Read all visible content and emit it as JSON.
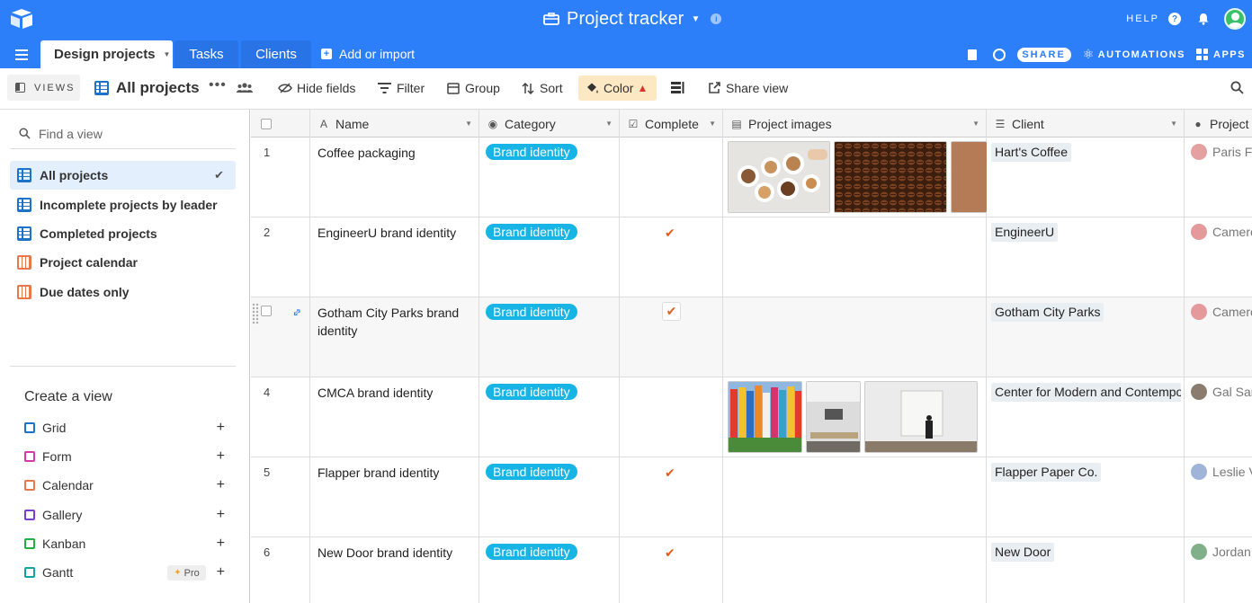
{
  "header": {
    "base_title": "Project tracker",
    "help": "HELP",
    "tabs": [
      {
        "label": "Design projects"
      },
      {
        "label": "Tasks"
      },
      {
        "label": "Clients"
      }
    ],
    "add_import": "Add or import",
    "share": "SHARE",
    "automations": "AUTOMATIONS",
    "apps": "APPS",
    "brand_color": "#2d7ff9"
  },
  "toolbar": {
    "views": "VIEWS",
    "current_view": "All projects",
    "hide_fields": "Hide fields",
    "filter": "Filter",
    "group": "Group",
    "sort": "Sort",
    "color": "Color",
    "share_view": "Share view"
  },
  "sidebar": {
    "find_placeholder": "Find a view",
    "views": [
      {
        "label": "All projects",
        "icon": "grid-icon",
        "selected": true
      },
      {
        "label": "Incomplete projects by leader",
        "icon": "grid-icon"
      },
      {
        "label": "Completed projects",
        "icon": "grid-icon"
      },
      {
        "label": "Project calendar",
        "icon": "calendar-icon"
      },
      {
        "label": "Due dates only",
        "icon": "calendar-icon"
      }
    ],
    "create_title": "Create a view",
    "create_items": [
      {
        "label": "Grid",
        "color": "#1d72c9"
      },
      {
        "label": "Form",
        "color": "#d63aa8"
      },
      {
        "label": "Calendar",
        "color": "#e8774a"
      },
      {
        "label": "Gallery",
        "color": "#7b3fd1"
      },
      {
        "label": "Kanban",
        "color": "#20b042"
      },
      {
        "label": "Gantt",
        "color": "#11a3a0"
      }
    ],
    "pro_label": "Pro"
  },
  "grid": {
    "columns": [
      "Name",
      "Category",
      "Complete",
      "Project images",
      "Client",
      "Project l"
    ],
    "rows": [
      {
        "num": "1",
        "name": "Coffee packaging",
        "category": "Brand identity",
        "complete": false,
        "client": "Hart's Coffee",
        "leader": "Paris Fo"
      },
      {
        "num": "2",
        "name": "EngineerU brand identity",
        "category": "Brand identity",
        "complete": true,
        "client": "EngineerU",
        "leader": "Camero"
      },
      {
        "num": "",
        "name": "Gotham City Parks brand identity",
        "category": "Brand identity",
        "complete": true,
        "client": "Gotham City Parks",
        "leader": "Camero"
      },
      {
        "num": "4",
        "name": "CMCA brand identity",
        "category": "Brand identity",
        "complete": false,
        "client": "Center for Modern and Contemporary Art",
        "leader": "Gal Sar"
      },
      {
        "num": "5",
        "name": "Flapper brand identity",
        "category": "Brand identity",
        "complete": true,
        "client": "Flapper Paper Co.",
        "leader": "Leslie V"
      },
      {
        "num": "6",
        "name": "New Door brand identity",
        "category": "Brand identity",
        "complete": true,
        "client": "New Door",
        "leader": "Jordan"
      }
    ],
    "category_color": "#19b4e6",
    "check_color": "#e25d1e"
  }
}
